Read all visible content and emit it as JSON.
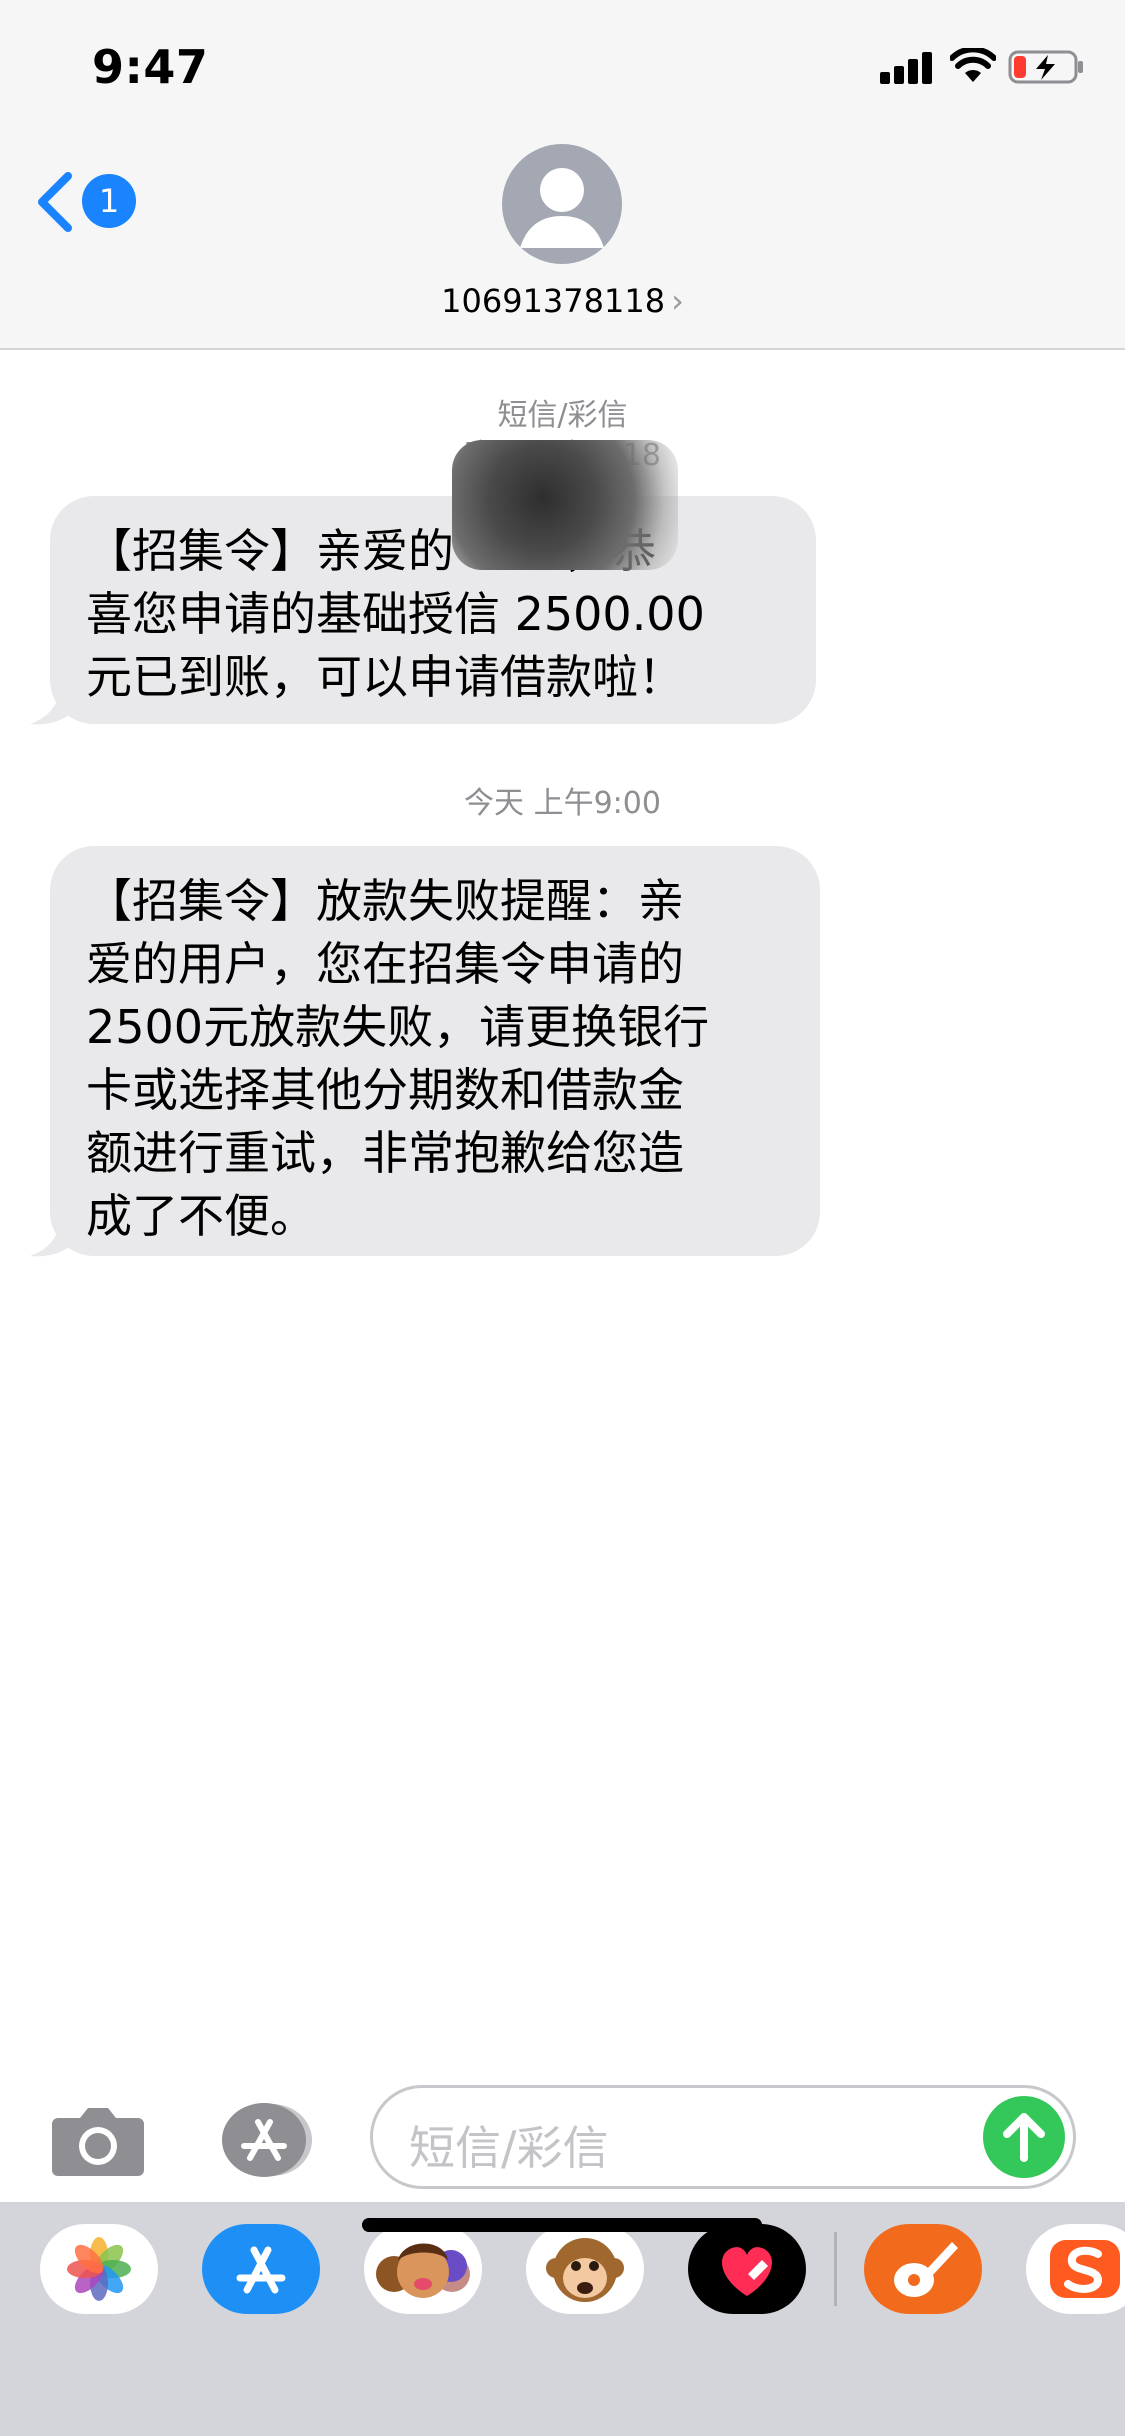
{
  "status_bar": {
    "time": "9:47"
  },
  "header": {
    "back_badge": "1",
    "contact_number": "10691378118",
    "contact_chevron": "›"
  },
  "conversation": {
    "message_type": "短信/彩信",
    "messages": [
      {
        "timestamp": "昨天 下午7:18",
        "lines": [
          "【招集令】亲爱的",
          "喜您申请的基础授信  2500.00",
          "元已到账，可以申请借款啦！"
        ],
        "line1_suffix": "，恭"
      },
      {
        "timestamp": "今天 上午9:00",
        "lines": [
          "【招集令】放款失败提醒：亲",
          "爱的用户，您在招集令申请的",
          "2500元放款失败，请更换银行",
          "卡或选择其他分期数和借款金",
          "额进行重试，非常抱歉给您造",
          "成了不便。"
        ]
      }
    ]
  },
  "composer": {
    "placeholder": "短信/彩信"
  },
  "app_drawer": {
    "apps": [
      "photos-icon",
      "app-store-icon",
      "memoji-icon",
      "animoji-monkey-icon",
      "digital-touch-icon",
      "garageband-icon",
      "sogou-input-icon"
    ]
  },
  "colors": {
    "accent": "#1a84ff",
    "send": "#34c759",
    "bubble": "#e9e9eb",
    "secondary_text": "#8e8e93"
  }
}
